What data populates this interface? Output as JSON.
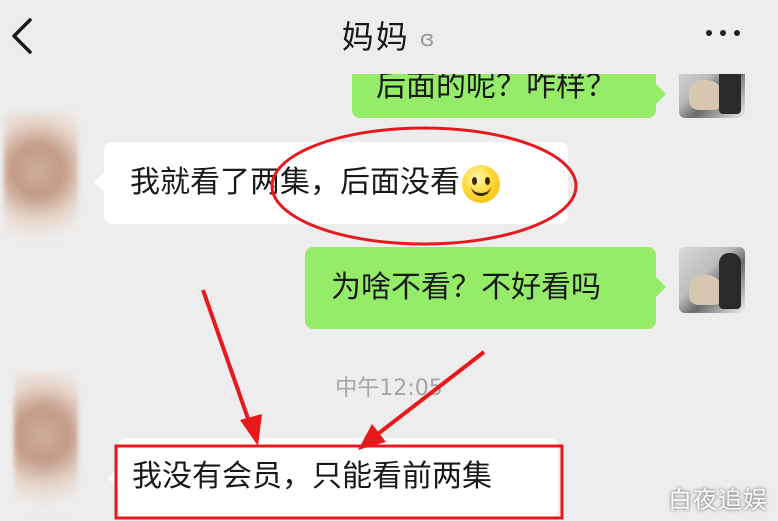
{
  "header": {
    "title": "妈妈",
    "ear_icon": "ear-icon",
    "back_icon": "chevron-left-icon",
    "more_icon": "more-dots-icon"
  },
  "messages": [
    {
      "side": "right",
      "text": "后面的呢？咋样？"
    },
    {
      "side": "left",
      "text": "我就看了两集，后面没看",
      "emoji": "smiley-emoji"
    },
    {
      "side": "right",
      "text": "为啥不看？不好看吗"
    },
    {
      "side": "left",
      "text": "我没有会员，只能看前两集"
    }
  ],
  "timestamp": "中午12:05",
  "watermark": "白夜追娱",
  "annotation_color": "#e8191d",
  "colors": {
    "background": "#ededed",
    "incoming_bubble": "#ffffff",
    "outgoing_bubble": "#95ec69"
  }
}
